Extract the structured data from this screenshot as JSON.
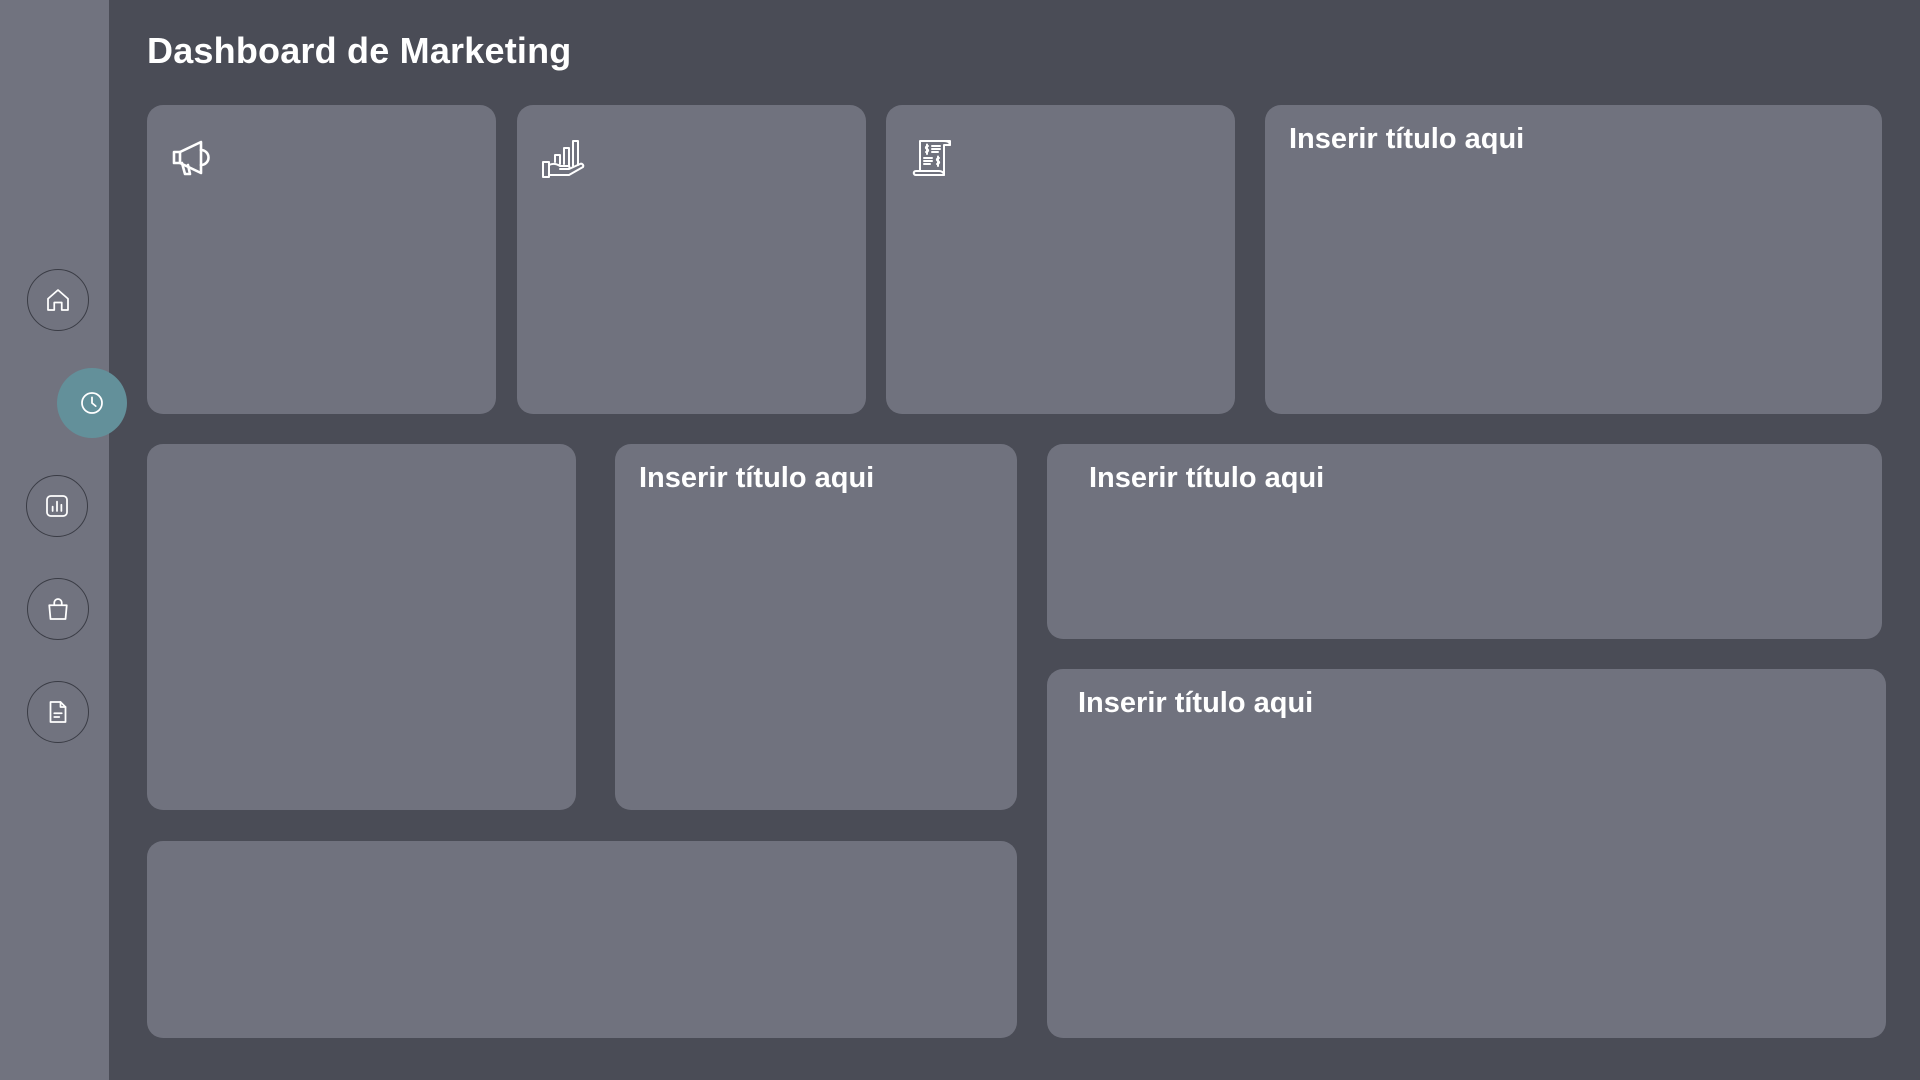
{
  "header": {
    "title": "Dashboard de Marketing"
  },
  "sidebar": {
    "items": [
      {
        "name": "home",
        "icon": "home-icon",
        "active": false
      },
      {
        "name": "history",
        "icon": "clock-icon",
        "active": true
      },
      {
        "name": "analytics",
        "icon": "bar-chart-icon",
        "active": false
      },
      {
        "name": "shop",
        "icon": "shopping-bag-icon",
        "active": false
      },
      {
        "name": "documents",
        "icon": "document-icon",
        "active": false
      }
    ]
  },
  "cards": {
    "kpi_1": {
      "icon": "megaphone-icon"
    },
    "kpi_2": {
      "icon": "growth-hand-icon"
    },
    "kpi_3": {
      "icon": "invoice-icon"
    },
    "top_right": {
      "title": "Inserir título aqui"
    },
    "middle_center": {
      "title": "Inserir título aqui"
    },
    "middle_right": {
      "title": "Inserir título aqui"
    },
    "bottom_right": {
      "title": "Inserir título aqui"
    }
  },
  "colors": {
    "background": "#4a4c56",
    "sidebar": "#71737f",
    "card": "#70727e",
    "accent": "#63909a",
    "text": "#ffffff"
  }
}
